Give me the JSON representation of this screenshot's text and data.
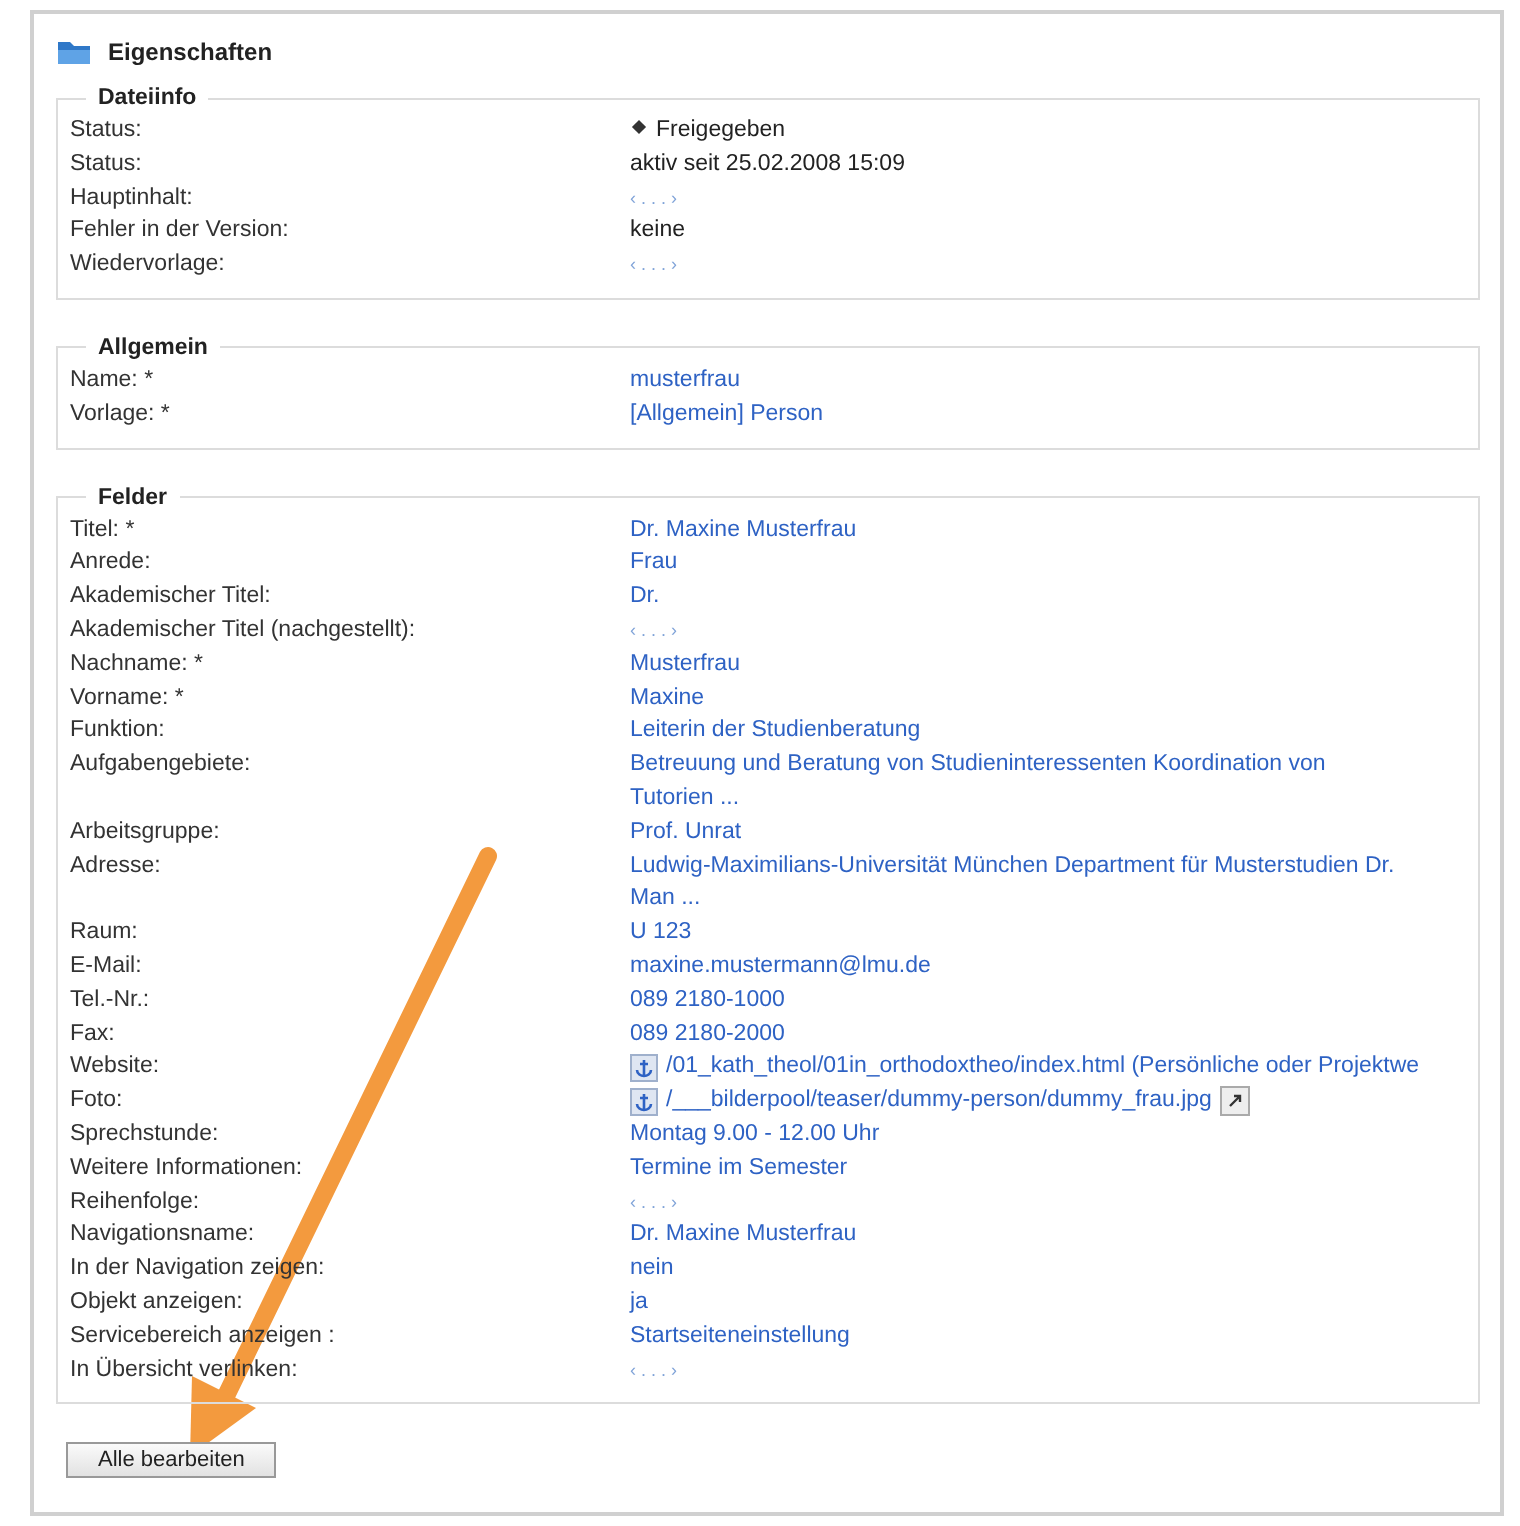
{
  "title": "Eigenschaften",
  "sections": [
    {
      "title": "Dateiinfo",
      "rows": [
        {
          "label": "Status:",
          "kind": "status",
          "value": "Freigegeben"
        },
        {
          "label": "Status:",
          "kind": "text",
          "value": "aktiv seit 25.02.2008 15:09"
        },
        {
          "label": "Hauptinhalt:",
          "kind": "empty",
          "value": "‹ . . . ›"
        },
        {
          "label": "Fehler in der Version:",
          "kind": "text",
          "value": "keine"
        },
        {
          "label": "Wiedervorlage:",
          "kind": "empty",
          "value": "‹ . . . ›"
        }
      ]
    },
    {
      "title": "Allgemein",
      "rows": [
        {
          "label": "Name: *",
          "kind": "link",
          "value": "musterfrau"
        },
        {
          "label": "Vorlage: *",
          "kind": "link",
          "value": "[Allgemein] Person"
        }
      ]
    },
    {
      "title": "Felder",
      "rows": [
        {
          "label": "Titel: *",
          "kind": "link",
          "value": "Dr. Maxine Musterfrau"
        },
        {
          "label": "Anrede:",
          "kind": "link",
          "value": "Frau"
        },
        {
          "label": "Akademischer Titel:",
          "kind": "link",
          "value": "Dr."
        },
        {
          "label": "Akademischer Titel (nachgestellt):",
          "kind": "empty",
          "value": "‹ . . . ›"
        },
        {
          "label": "Nachname: *",
          "kind": "link",
          "value": "Musterfrau"
        },
        {
          "label": "Vorname: *",
          "kind": "link",
          "value": "Maxine"
        },
        {
          "label": "Funktion:",
          "kind": "link",
          "value": "Leiterin der Studienberatung"
        },
        {
          "label": "Aufgabengebiete:",
          "kind": "link",
          "value": "Betreuung und Beratung von Studieninteressenten Koordination von Tutorien ..."
        },
        {
          "label": "Arbeitsgruppe:",
          "kind": "link",
          "value": "Prof. Unrat"
        },
        {
          "label": "Adresse:",
          "kind": "link",
          "value": "Ludwig-Maximilians-Universität München Department für Musterstudien Dr. Man ..."
        },
        {
          "label": "Raum:",
          "kind": "link",
          "value": "U 123"
        },
        {
          "label": "E-Mail:",
          "kind": "link",
          "value": "maxine.mustermann@lmu.de"
        },
        {
          "label": "Tel.-Nr.:",
          "kind": "link",
          "value": "089 2180-1000"
        },
        {
          "label": "Fax:",
          "kind": "link",
          "value": "089 2180-2000"
        },
        {
          "label": "Website:",
          "kind": "file",
          "value": "/01_kath_theol/01in_orthodoxtheo/index.html (Persönliche oder Projektwe",
          "open_button": false
        },
        {
          "label": "Foto:",
          "kind": "file",
          "value": "/___bilderpool/teaser/dummy-person/dummy_frau.jpg",
          "open_button": true
        },
        {
          "label": "Sprechstunde:",
          "kind": "link",
          "value": "Montag 9.00 - 12.00 Uhr"
        },
        {
          "label": "Weitere Informationen:",
          "kind": "link",
          "value": "Termine im Semester"
        },
        {
          "label": "Reihenfolge:",
          "kind": "empty",
          "value": "‹ . . . ›"
        },
        {
          "label": "Navigationsname:",
          "kind": "link",
          "value": "Dr. Maxine Musterfrau"
        },
        {
          "label": "In der Navigation zeigen:",
          "kind": "link",
          "value": "nein"
        },
        {
          "label": "Objekt anzeigen:",
          "kind": "link",
          "value": "ja"
        },
        {
          "label": "Servicebereich anzeigen :",
          "kind": "link",
          "value": "Startseiteneinstellung"
        },
        {
          "label": "In Übersicht verlinken:",
          "kind": "empty",
          "value": "‹ . . . ›"
        }
      ]
    }
  ],
  "button": "Alle bearbeiten"
}
